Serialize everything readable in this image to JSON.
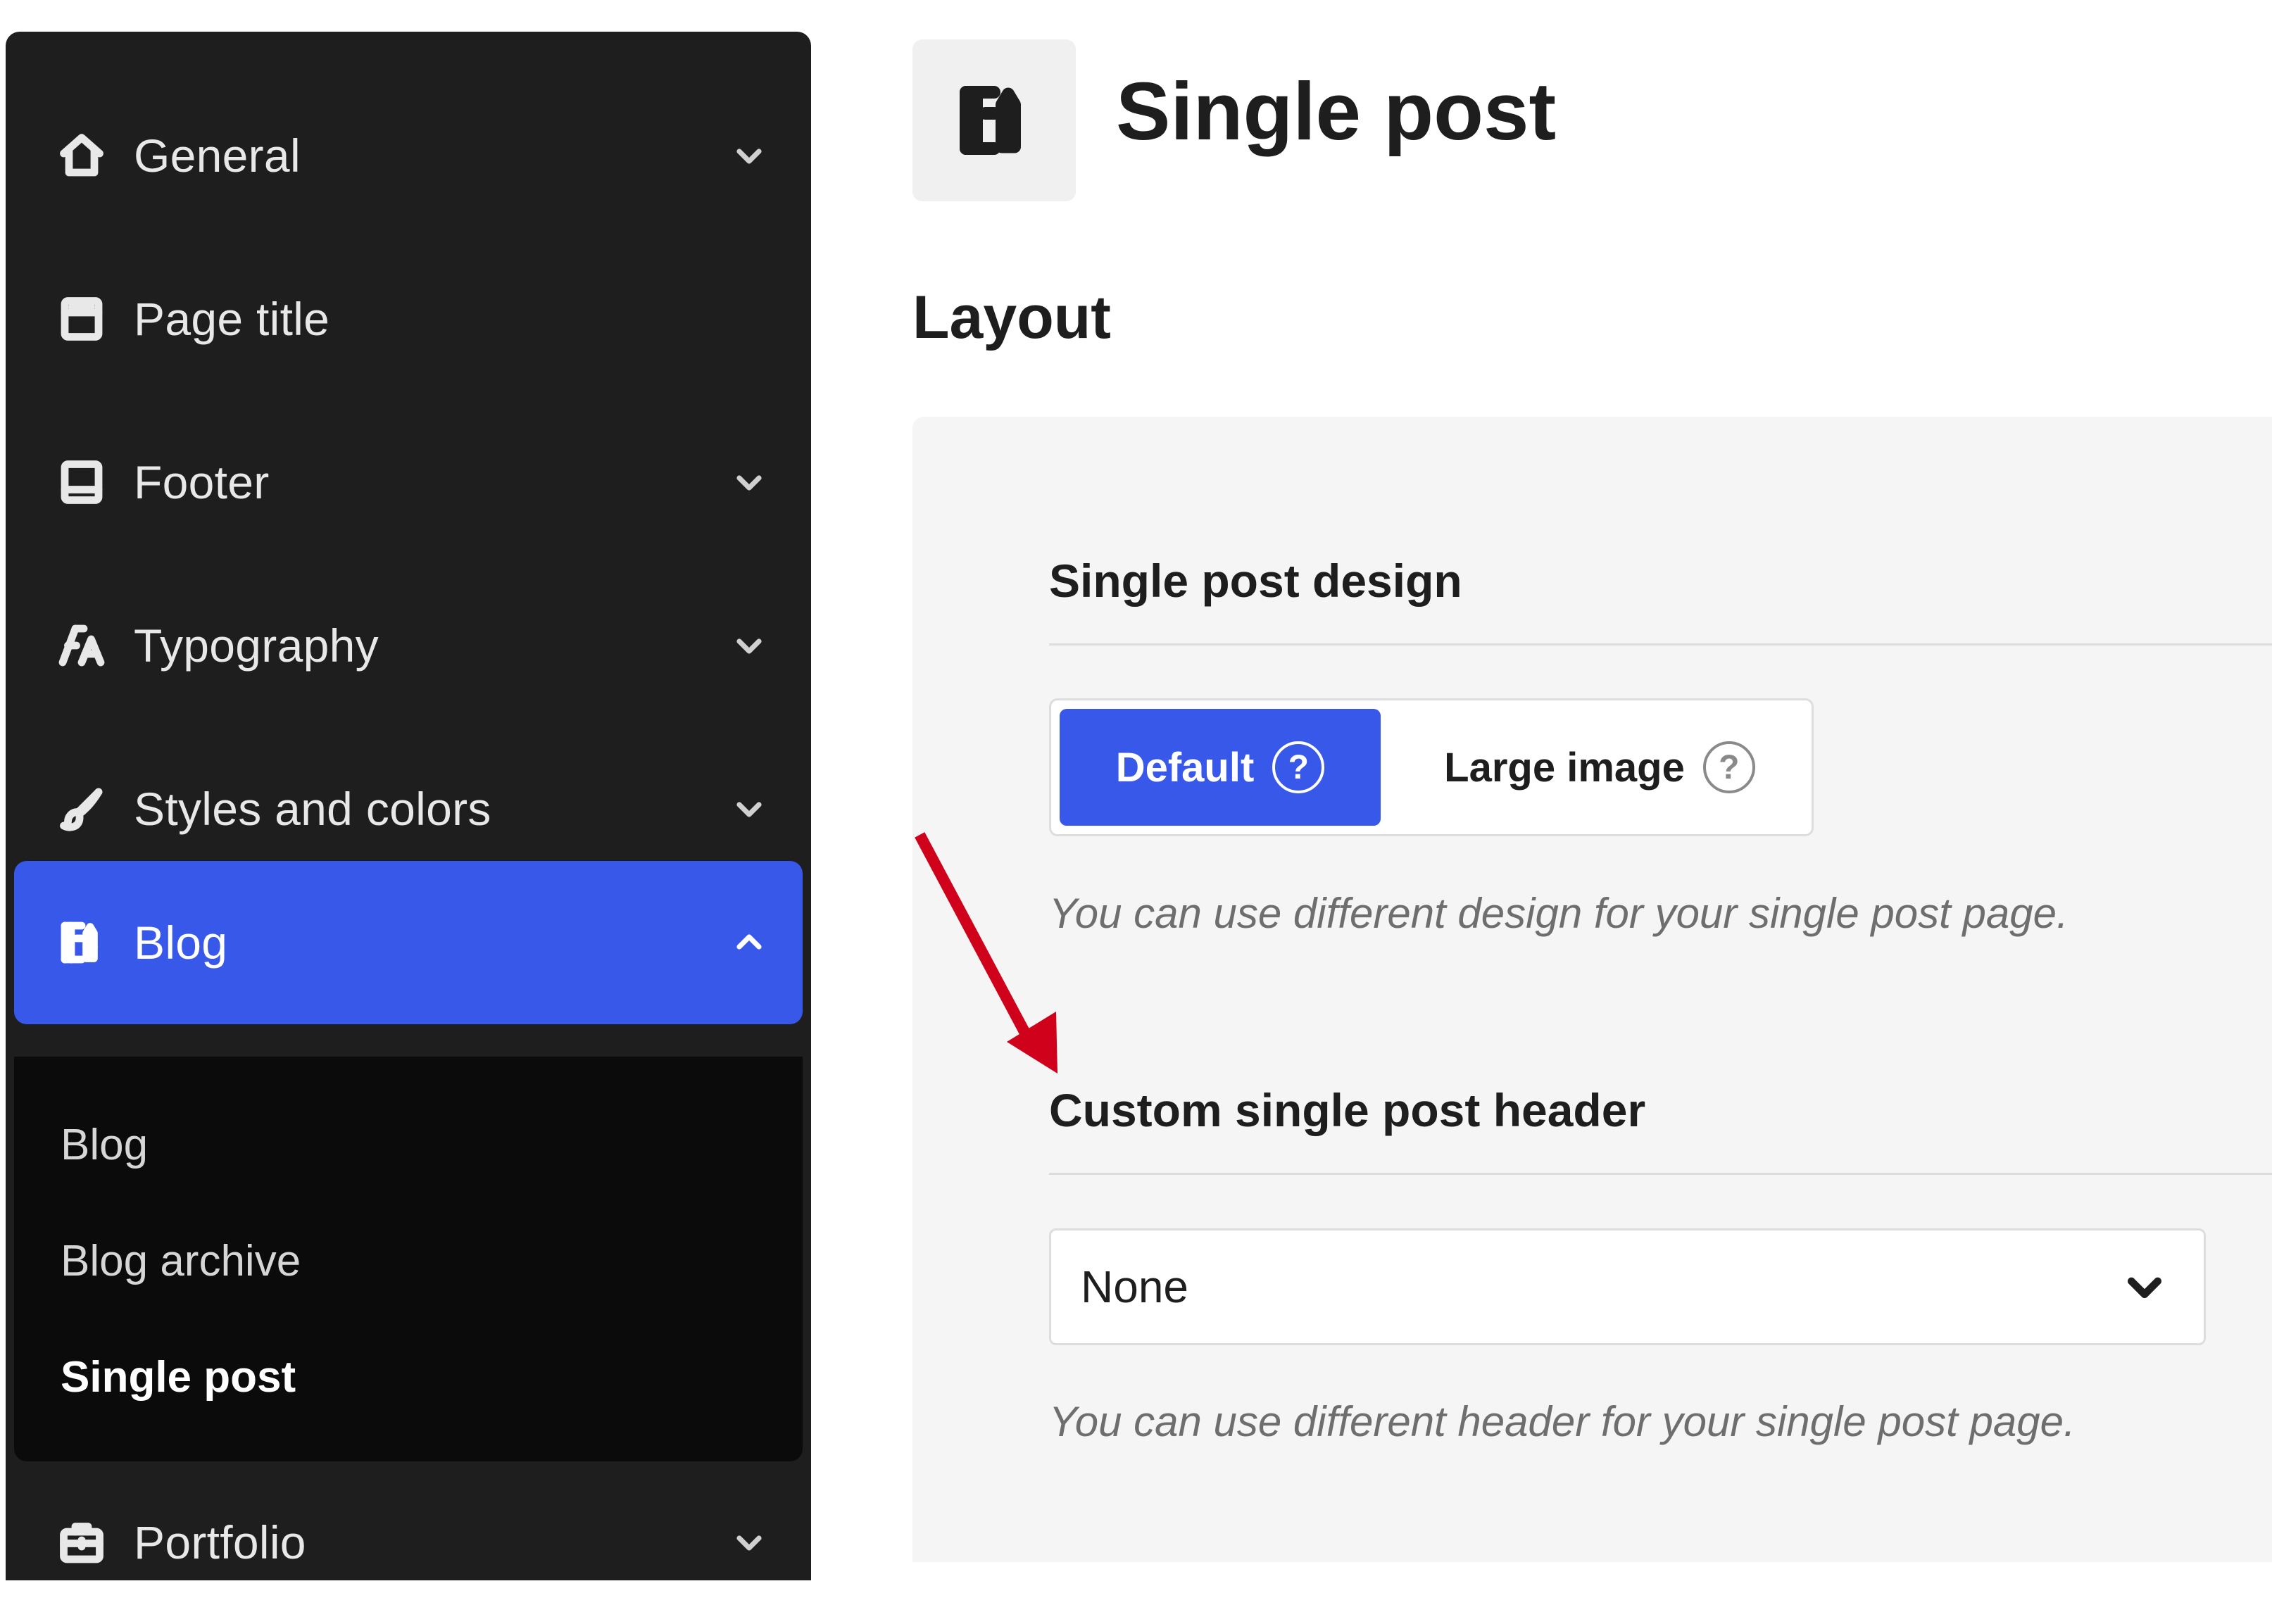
{
  "sidebar": {
    "items": [
      {
        "label": "General",
        "icon": "home-icon"
      },
      {
        "label": "Page title",
        "icon": "page-title-icon"
      },
      {
        "label": "Footer",
        "icon": "footer-icon"
      },
      {
        "label": "Typography",
        "icon": "typography-icon"
      },
      {
        "label": "Styles and colors",
        "icon": "brush-icon"
      },
      {
        "label": "Blog",
        "icon": "blog-icon",
        "active": true,
        "expanded": true
      },
      {
        "label": "Portfolio",
        "icon": "briefcase-icon"
      }
    ],
    "submenu": [
      {
        "label": "Blog"
      },
      {
        "label": "Blog archive"
      },
      {
        "label": "Single post",
        "current": true
      }
    ]
  },
  "header": {
    "title": "Single post",
    "icon": "blog-icon"
  },
  "layout": {
    "section_title": "Layout",
    "single_post_design": {
      "label": "Single post design",
      "options": [
        {
          "label": "Default",
          "selected": true
        },
        {
          "label": "Large image",
          "selected": false
        }
      ],
      "help_glyph": "?",
      "help_text": "You can use different design for your single post page."
    },
    "custom_header": {
      "label": "Custom single post header",
      "selected_value": "None",
      "help_text": "You can use different header for your single post page."
    }
  },
  "colors": {
    "accent": "#3858e9",
    "sidebar_bg": "#1e1e1e",
    "submenu_bg": "#0b0b0b",
    "panel_bg": "#f5f5f5",
    "annotation_arrow": "#d0021b"
  }
}
